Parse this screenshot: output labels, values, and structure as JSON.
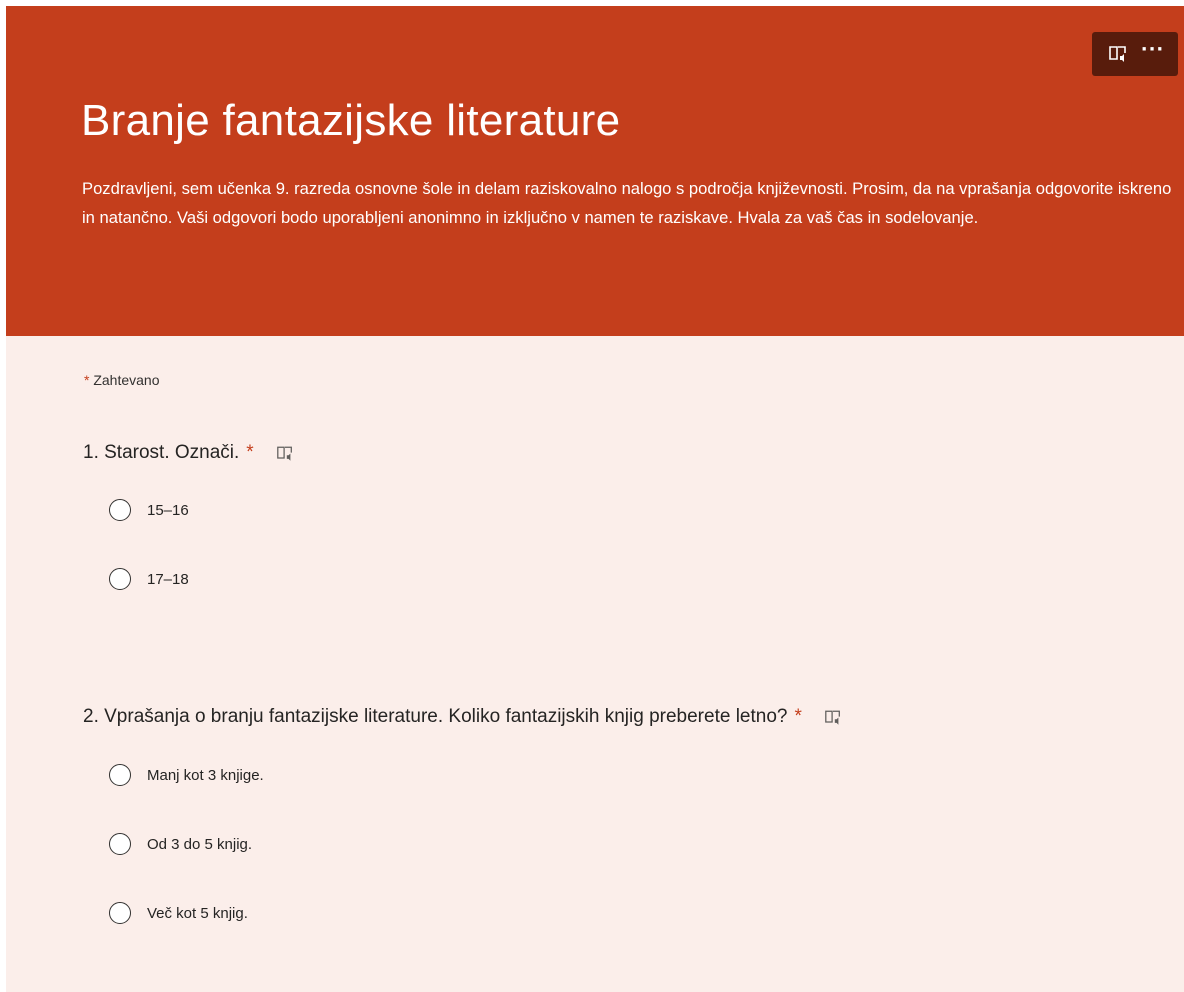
{
  "form": {
    "title": "Branje fantazijske literature",
    "description": "Pozdravljeni, sem učenka 9. razreda osnovne šole in delam raziskovalno nalogo s področja književnosti. Prosim, da na vprašanja odgovorite iskreno in natančno. Vaši odgovori bodo uporabljeni anonimno in izključno v namen te raziskave. Hvala za vaš čas in sodelovanje.",
    "required_marker": "*",
    "required_note": "Zahtevano",
    "more_label": "···"
  },
  "colors": {
    "header": "#c43e1c",
    "background": "#fbeeea",
    "required_star": "#c43e1c"
  },
  "icons": {
    "toolbar_reader": "immersive-reader-icon",
    "toolbar_more": "more-options-icon",
    "question_reader": "immersive-reader-icon",
    "option": "radio-button"
  },
  "questions": [
    {
      "title": "1. Starost. Označi.",
      "required": "*",
      "options": [
        "15–16",
        "17–18"
      ]
    },
    {
      "title": "2. Vprašanja o branju fantazijske literature. Koliko fantazijskih knjig preberete letno?",
      "required": "*",
      "options": [
        "Manj kot 3 knjige.",
        "Od 3 do 5 knjig.",
        "Več kot 5 knjig."
      ]
    }
  ]
}
